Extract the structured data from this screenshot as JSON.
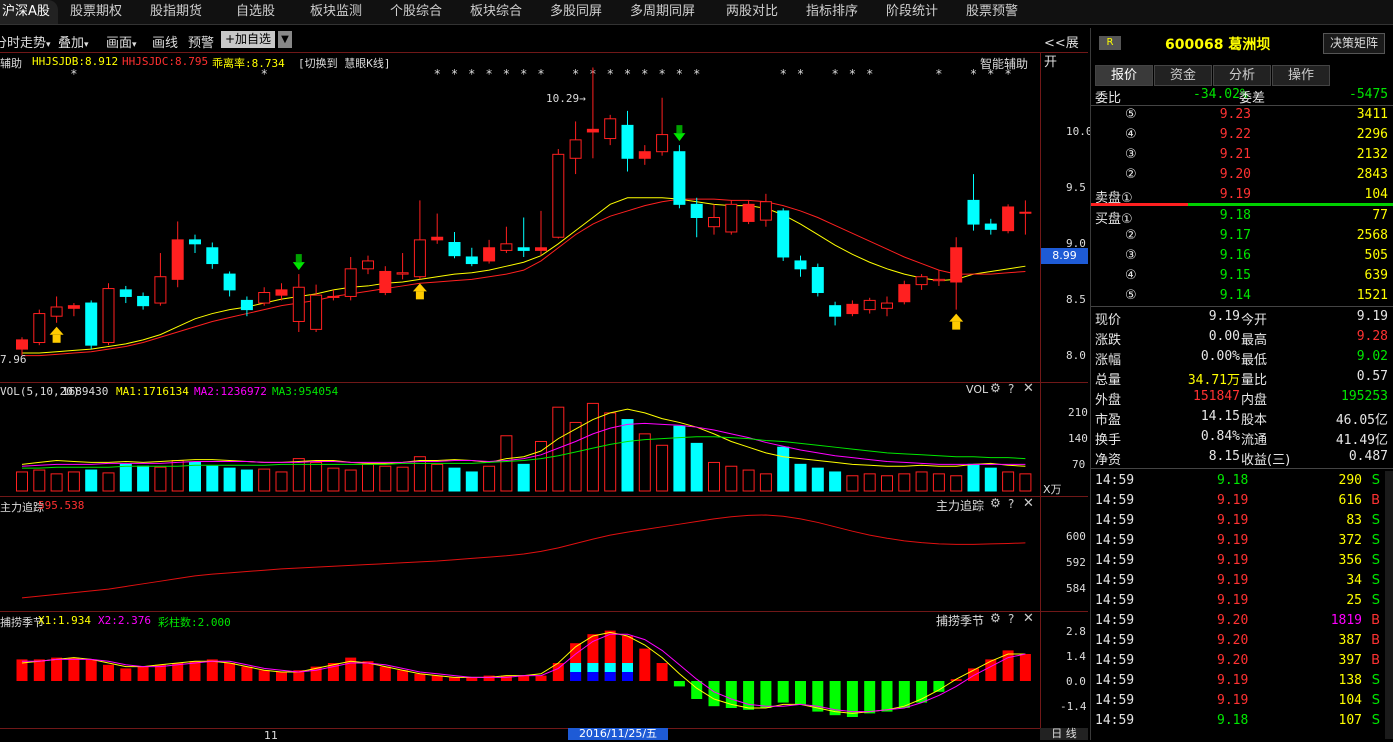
{
  "topnav": {
    "tabs": [
      "沪深A股",
      "股票期权",
      "股指期货",
      "自选股",
      "板块监测",
      "个股综合",
      "板块综合",
      "多股同屏",
      "多周期同屏",
      "两股对比",
      "指标排序",
      "阶段统计",
      "股票预警"
    ]
  },
  "toolbar": {
    "items": [
      "分时走势",
      "叠加",
      "画面",
      "画线",
      "预警"
    ],
    "add_fav": "+加自选",
    "expand": "<<展开"
  },
  "main_panel": {
    "title": "智能辅助",
    "legend": {
      "hh_label": "HHJSJDB:8.912",
      "hl_label": "HHJSJDC:8.795",
      "deviation_label": "乖离率:8.734",
      "switch_text": "[切换到 慧眼K线]"
    },
    "price_high_label": "10.29→",
    "price_low_label": "7.96",
    "price_axis": [
      "10.0",
      "9.5",
      "9.0",
      "8.5",
      "8.0"
    ],
    "current_price_tag": "8.99"
  },
  "vol_panel": {
    "legend_params": "VOL(5,10,20)",
    "legend_vol": "1689430",
    "ma1": "MA1:1716134",
    "ma2": "MA2:1236972",
    "ma3": "MA3:954054",
    "title": "VOL",
    "axis": [
      "210",
      "140",
      "70"
    ],
    "unit": "X万"
  },
  "trace_panel": {
    "legend_name": "主力追踪",
    "legend_value": "595.538",
    "title": "主力追踪",
    "axis": [
      "600",
      "592",
      "584"
    ]
  },
  "season_panel": {
    "legend_name": "捕捞季节",
    "x1": "X1:1.934",
    "x2": "X2:2.376",
    "bars": "彩柱数:2.000",
    "title": "捕捞季节",
    "axis": [
      "2.8",
      "1.4",
      "0.0",
      "-1.4"
    ]
  },
  "bottom": {
    "month_label": "11",
    "date_label": "2016/11/25/五",
    "period": "日 线"
  },
  "quote": {
    "badge": "R",
    "code_name": "600068 葛洲坝",
    "strategy_button": "决策矩阵",
    "tabs": [
      "报价",
      "资金",
      "分析",
      "操作"
    ],
    "weibi_label": "委比",
    "weibi_value": "-34.02%",
    "weicha_label": "委差",
    "weicha_value": "-5475",
    "sell": [
      {
        "label": "⑤",
        "price": "9.23",
        "vol": "3411"
      },
      {
        "label": "④",
        "price": "9.22",
        "vol": "2296"
      },
      {
        "label": "③",
        "price": "9.21",
        "vol": "2132"
      },
      {
        "label": "②",
        "price": "9.20",
        "vol": "2843"
      },
      {
        "label": "卖盘①",
        "price": "9.19",
        "vol": "104"
      }
    ],
    "buy": [
      {
        "label": "买盘①",
        "price": "9.18",
        "vol": "77"
      },
      {
        "label": "②",
        "price": "9.17",
        "vol": "2568"
      },
      {
        "label": "③",
        "price": "9.16",
        "vol": "505"
      },
      {
        "label": "④",
        "price": "9.15",
        "vol": "639"
      },
      {
        "label": "⑤",
        "price": "9.14",
        "vol": "1521"
      }
    ],
    "stats": [
      {
        "l1": "现价",
        "v1": "9.19",
        "l2": "今开",
        "v2": "9.19"
      },
      {
        "l1": "涨跌",
        "v1": "0.00",
        "l2": "最高",
        "v2": "9.28"
      },
      {
        "l1": "涨幅",
        "v1": "0.00%",
        "l2": "最低",
        "v2": "9.02"
      },
      {
        "l1": "总量",
        "v1": "34.71万",
        "l2": "量比",
        "v2": "0.57"
      },
      {
        "l1": "外盘",
        "v1": "151847",
        "l2": "内盘",
        "v2": "195253"
      },
      {
        "l1": "市盈",
        "v1": "14.15",
        "l2": "股本",
        "v2": "46.05亿"
      },
      {
        "l1": "换手",
        "v1": "0.84%",
        "l2": "流通",
        "v2": "41.49亿"
      },
      {
        "l1": "净资",
        "v1": "8.15",
        "l2": "收益(三)",
        "v2": "0.487"
      }
    ],
    "ticks": [
      {
        "time": "14:59",
        "price": "9.18",
        "vol": "290",
        "side": "S"
      },
      {
        "time": "14:59",
        "price": "9.19",
        "vol": "616",
        "side": "B"
      },
      {
        "time": "14:59",
        "price": "9.19",
        "vol": "83",
        "side": "S"
      },
      {
        "time": "14:59",
        "price": "9.19",
        "vol": "372",
        "side": "S"
      },
      {
        "time": "14:59",
        "price": "9.19",
        "vol": "356",
        "side": "S"
      },
      {
        "time": "14:59",
        "price": "9.19",
        "vol": "34",
        "side": "S"
      },
      {
        "time": "14:59",
        "price": "9.19",
        "vol": "25",
        "side": "S"
      },
      {
        "time": "14:59",
        "price": "9.20",
        "vol": "1819",
        "side": "B"
      },
      {
        "time": "14:59",
        "price": "9.20",
        "vol": "387",
        "side": "B"
      },
      {
        "time": "14:59",
        "price": "9.20",
        "vol": "397",
        "side": "B"
      },
      {
        "time": "14:59",
        "price": "9.19",
        "vol": "138",
        "side": "S"
      },
      {
        "time": "14:59",
        "price": "9.19",
        "vol": "104",
        "side": "S"
      },
      {
        "time": "14:59",
        "price": "9.18",
        "vol": "107",
        "side": "S"
      }
    ]
  },
  "chart_data": {
    "type": "candlestick",
    "ylim": [
      7.9,
      10.4
    ],
    "candles": [
      [
        8.15,
        8.22,
        8.1,
        8.24
      ],
      [
        8.2,
        8.42,
        8.18,
        8.45
      ],
      [
        8.4,
        8.47,
        8.35,
        8.55
      ],
      [
        8.46,
        8.48,
        8.4,
        8.5
      ],
      [
        8.5,
        8.18,
        8.15,
        8.52
      ],
      [
        8.2,
        8.61,
        8.18,
        8.65
      ],
      [
        8.6,
        8.55,
        8.5,
        8.63
      ],
      [
        8.55,
        8.48,
        8.45,
        8.58
      ],
      [
        8.5,
        8.7,
        8.48,
        8.88
      ],
      [
        8.68,
        8.98,
        8.62,
        9.12
      ],
      [
        8.98,
        8.95,
        8.88,
        9.02
      ],
      [
        8.92,
        8.8,
        8.76,
        8.96
      ],
      [
        8.72,
        8.6,
        8.55,
        8.74
      ],
      [
        8.52,
        8.45,
        8.4,
        8.55
      ],
      [
        8.5,
        8.58,
        8.48,
        8.62
      ],
      [
        8.56,
        8.6,
        8.52,
        8.65
      ],
      [
        8.36,
        8.62,
        8.28,
        8.72
      ],
      [
        8.3,
        8.56,
        8.28,
        8.64
      ],
      [
        8.55,
        8.55,
        8.52,
        8.6
      ],
      [
        8.55,
        8.76,
        8.52,
        8.85
      ],
      [
        8.76,
        8.82,
        8.72,
        8.86
      ],
      [
        8.58,
        8.74,
        8.56,
        8.78
      ],
      [
        8.72,
        8.73,
        8.68,
        8.88
      ],
      [
        8.7,
        8.98,
        8.68,
        9.28
      ],
      [
        8.98,
        9.0,
        8.95,
        9.18
      ],
      [
        8.96,
        8.86,
        8.84,
        9.04
      ],
      [
        8.85,
        8.8,
        8.78,
        8.92
      ],
      [
        8.82,
        8.92,
        8.8,
        8.98
      ],
      [
        8.9,
        8.95,
        8.88,
        9.08
      ],
      [
        8.92,
        8.9,
        8.85,
        9.15
      ],
      [
        8.9,
        8.92,
        8.86,
        9.2
      ],
      [
        9.0,
        9.63,
        8.99,
        9.67
      ],
      [
        9.6,
        9.74,
        9.48,
        9.88
      ],
      [
        9.8,
        9.82,
        9.6,
        10.29
      ],
      [
        9.75,
        9.9,
        9.7,
        9.93
      ],
      [
        9.85,
        9.6,
        9.5,
        9.96
      ],
      [
        9.6,
        9.65,
        9.55,
        9.7
      ],
      [
        9.65,
        9.78,
        9.62,
        10.06
      ],
      [
        9.65,
        9.25,
        9.22,
        9.7
      ],
      [
        9.25,
        9.15,
        9.0,
        9.3
      ],
      [
        9.08,
        9.15,
        9.02,
        9.25
      ],
      [
        9.04,
        9.25,
        9.02,
        9.28
      ],
      [
        9.12,
        9.25,
        9.1,
        9.28
      ],
      [
        9.13,
        9.27,
        9.08,
        9.33
      ],
      [
        9.2,
        8.85,
        8.82,
        9.22
      ],
      [
        8.82,
        8.76,
        8.7,
        8.86
      ],
      [
        8.77,
        8.58,
        8.55,
        8.8
      ],
      [
        8.48,
        8.4,
        8.33,
        8.51
      ],
      [
        8.42,
        8.49,
        8.4,
        8.52
      ],
      [
        8.45,
        8.52,
        8.42,
        8.54
      ],
      [
        8.46,
        8.5,
        8.4,
        8.55
      ],
      [
        8.51,
        8.64,
        8.49,
        8.67
      ],
      [
        8.64,
        8.7,
        8.6,
        8.72
      ],
      [
        8.67,
        8.68,
        8.63,
        8.75
      ],
      [
        8.66,
        8.92,
        8.45,
        9.0
      ],
      [
        9.28,
        9.1,
        9.05,
        9.48
      ],
      [
        9.1,
        9.06,
        9.02,
        9.14
      ],
      [
        9.05,
        9.23,
        9.03,
        9.25
      ],
      [
        9.19,
        9.19,
        9.02,
        9.28
      ]
    ],
    "ma_yellow": [
      8.12,
      8.12,
      8.13,
      8.14,
      8.15,
      8.17,
      8.19,
      8.22,
      8.26,
      8.32,
      8.38,
      8.42,
      8.45,
      8.47,
      8.5,
      8.53,
      8.55,
      8.57,
      8.6,
      8.62,
      8.63,
      8.65,
      8.66,
      8.68,
      8.7,
      8.72,
      8.73,
      8.75,
      8.78,
      8.81,
      8.86,
      8.95,
      9.05,
      9.15,
      9.25,
      9.3,
      9.3,
      9.3,
      9.29,
      9.27,
      9.25,
      9.24,
      9.24,
      9.22,
      9.17,
      9.1,
      9.02,
      8.94,
      8.87,
      8.81,
      8.76,
      8.72,
      8.69,
      8.67,
      8.68,
      8.72,
      8.74,
      8.76,
      8.78
    ],
    "ma_red": [
      8.1,
      8.1,
      8.11,
      8.12,
      8.13,
      8.15,
      8.17,
      8.2,
      8.24,
      8.28,
      8.32,
      8.36,
      8.39,
      8.42,
      8.45,
      8.48,
      8.5,
      8.52,
      8.55,
      8.57,
      8.59,
      8.61,
      8.63,
      8.65,
      8.66,
      8.67,
      8.68,
      8.7,
      8.72,
      8.75,
      8.82,
      8.92,
      9.02,
      9.1,
      9.16,
      9.2,
      9.24,
      9.27,
      9.29,
      9.29,
      9.29,
      9.28,
      9.28,
      9.27,
      9.24,
      9.2,
      9.15,
      9.09,
      9.03,
      8.97,
      8.91,
      8.85,
      8.8,
      8.75,
      8.72,
      8.72,
      8.72,
      8.73,
      8.74
    ],
    "volumes": [
      20,
      22,
      18,
      20,
      22,
      19,
      28,
      26,
      25,
      32,
      30,
      26,
      24,
      22,
      23,
      20,
      34,
      30,
      24,
      22,
      28,
      26,
      25,
      36,
      28,
      24,
      20,
      26,
      58,
      28,
      52,
      88,
      72,
      92,
      82,
      75,
      60,
      48,
      68,
      50,
      30,
      26,
      22,
      18,
      46,
      28,
      24,
      20,
      16,
      18,
      16,
      18,
      20,
      18,
      16,
      28,
      24,
      20,
      18
    ],
    "ma_vol": [
      [
        28,
        30,
        32,
        31,
        30,
        30,
        31,
        30,
        31,
        32,
        33,
        33,
        32,
        31,
        30,
        30,
        31,
        32,
        32,
        30,
        29,
        29,
        30,
        32,
        32,
        33,
        32,
        30,
        34,
        36,
        42,
        55,
        65,
        75,
        82,
        86,
        82,
        76,
        72,
        67,
        60,
        52,
        46,
        40,
        36,
        34,
        32,
        30,
        28,
        27,
        26,
        26,
        27,
        26,
        26,
        28,
        29,
        27,
        26
      ],
      [
        26,
        27,
        28,
        28,
        28,
        29,
        29,
        29,
        29,
        30,
        31,
        31,
        31,
        31,
        30,
        30,
        30,
        31,
        31,
        30,
        30,
        30,
        30,
        31,
        31,
        32,
        32,
        31,
        32,
        34,
        38,
        45,
        52,
        60,
        66,
        70,
        71,
        70,
        69,
        67,
        64,
        60,
        56,
        51,
        47,
        43,
        40,
        37,
        35,
        33,
        31,
        30,
        29,
        28,
        28,
        28,
        28,
        28,
        28
      ],
      [
        24,
        24,
        25,
        25,
        25,
        25,
        26,
        26,
        26,
        26,
        27,
        27,
        27,
        27,
        27,
        28,
        28,
        28,
        28,
        28,
        28,
        28,
        29,
        29,
        29,
        29,
        29,
        30,
        31,
        32,
        34,
        37,
        41,
        45,
        49,
        52,
        54,
        55,
        56,
        57,
        57,
        56,
        55,
        53,
        52,
        50,
        48,
        46,
        44,
        42,
        40,
        39,
        38,
        37,
        36,
        36,
        35,
        35,
        34
      ]
    ],
    "trace": [
      583,
      583.4,
      583.8,
      584.2,
      584.6,
      585,
      585.6,
      586.2,
      586.8,
      587.4,
      588,
      588.4,
      588.7,
      589,
      589.3,
      589.6,
      589.8,
      590,
      590.2,
      590.4,
      590.6,
      590.8,
      591,
      591.2,
      591.4,
      591.7,
      592,
      592.3,
      592.6,
      593,
      593.6,
      594.4,
      595.4,
      596.4,
      597.3,
      598,
      598.6,
      599.2,
      599.8,
      600.4,
      601,
      601.5,
      601.8,
      601.9,
      601.6,
      601,
      600.2,
      599.2,
      598.2,
      597.3,
      596.6,
      596,
      595.6,
      595.3,
      595.2,
      595.2,
      595.3,
      595.4,
      595.54
    ],
    "season_bars": [
      1.2,
      1.2,
      1.3,
      1.3,
      1.2,
      0.9,
      0.7,
      0.8,
      0.9,
      1.0,
      1.1,
      1.2,
      1.0,
      0.8,
      0.6,
      0.5,
      0.6,
      0.8,
      1.0,
      1.3,
      1.1,
      0.8,
      0.6,
      0.4,
      0.3,
      0.2,
      0.2,
      0.3,
      0.3,
      0.3,
      0.3,
      1.0,
      2.1,
      2.6,
      2.8,
      2.5,
      1.8,
      1.0,
      -0.3,
      -1.0,
      -1.4,
      -1.5,
      -1.6,
      -1.5,
      -1.2,
      -1.3,
      -1.7,
      -1.9,
      -2.0,
      -1.8,
      -1.7,
      -1.5,
      -1.2,
      -0.6,
      0.1,
      0.7,
      1.2,
      1.7,
      1.5
    ],
    "season_x1": [
      1.0,
      1.1,
      1.2,
      1.3,
      1.2,
      1.0,
      0.8,
      0.8,
      0.9,
      1.0,
      1.1,
      1.1,
      1.0,
      0.8,
      0.6,
      0.5,
      0.5,
      0.7,
      0.9,
      1.1,
      1.0,
      0.8,
      0.6,
      0.4,
      0.3,
      0.2,
      0.2,
      0.2,
      0.3,
      0.3,
      0.4,
      1.0,
      1.9,
      2.5,
      2.7,
      2.5,
      2.0,
      1.3,
      0.4,
      -0.4,
      -1.0,
      -1.3,
      -1.5,
      -1.5,
      -1.3,
      -1.3,
      -1.5,
      -1.7,
      -1.8,
      -1.7,
      -1.6,
      -1.4,
      -1.0,
      -0.5,
      0.1,
      0.6,
      1.1,
      1.5,
      1.5
    ],
    "season_x2": [
      1.1,
      1.1,
      1.2,
      1.2,
      1.2,
      1.1,
      0.9,
      0.8,
      0.8,
      0.9,
      1.0,
      1.1,
      1.1,
      0.9,
      0.7,
      0.6,
      0.5,
      0.6,
      0.8,
      1.0,
      1.0,
      0.9,
      0.7,
      0.5,
      0.4,
      0.3,
      0.2,
      0.2,
      0.2,
      0.3,
      0.3,
      0.7,
      1.5,
      2.2,
      2.6,
      2.6,
      2.3,
      1.7,
      0.9,
      0.1,
      -0.6,
      -1.0,
      -1.3,
      -1.4,
      -1.4,
      -1.3,
      -1.4,
      -1.6,
      -1.7,
      -1.7,
      -1.6,
      -1.5,
      -1.2,
      -0.8,
      -0.3,
      0.3,
      0.8,
      1.3,
      1.5
    ],
    "down_markers": [
      16,
      38
    ],
    "up_markers": [
      2,
      23,
      54
    ]
  },
  "colors": {
    "up": "#ff2020",
    "down": "#00ffff",
    "ma_yellow": "#ffff00",
    "ma_red": "#ff2020",
    "vol_ma1": "#ffff00",
    "vol_ma2": "#ff00ff",
    "vol_ma3": "#00e600",
    "trace": "#e01010",
    "season_up": "#ff0000",
    "season_down": "#00ff00"
  }
}
